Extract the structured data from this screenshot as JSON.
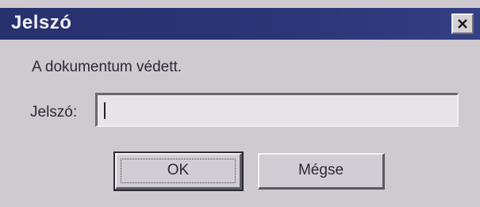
{
  "dialog": {
    "title": "Jelszó",
    "message": "A dokumentum védett.",
    "password_label": "Jelszó:",
    "password_value": "",
    "ok_label": "OK",
    "cancel_label": "Mégse",
    "close_icon": "close-icon",
    "colors": {
      "titlebar": "#27316e",
      "background": "#cfc9d0",
      "title_text": "#f0f0f5"
    }
  }
}
